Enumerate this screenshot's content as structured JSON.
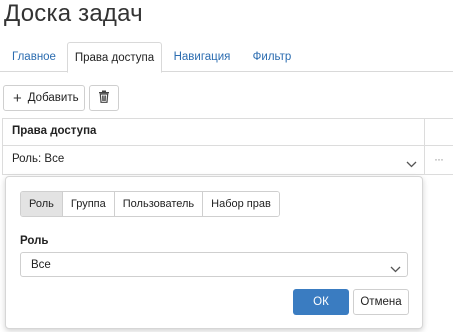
{
  "page": {
    "title": "Доска задач"
  },
  "tabs": [
    {
      "label": "Главное",
      "active": false
    },
    {
      "label": "Права доступа",
      "active": true
    },
    {
      "label": "Навигация",
      "active": false
    },
    {
      "label": "Фильтр",
      "active": false
    }
  ],
  "toolbar": {
    "add_label": "Добавить",
    "add_icon": "plus-icon",
    "delete_icon": "trash-icon"
  },
  "grid": {
    "header": "Права доступа",
    "rows": [
      {
        "value": "Роль: Все"
      }
    ],
    "row_menu": "···"
  },
  "popup": {
    "segments": [
      {
        "label": "Роль",
        "active": true
      },
      {
        "label": "Группа",
        "active": false
      },
      {
        "label": "Пользователь",
        "active": false
      },
      {
        "label": "Набор прав",
        "active": false
      }
    ],
    "field_label": "Роль",
    "select_value": "Все",
    "ok_label": "ОК",
    "cancel_label": "Отмена"
  },
  "colors": {
    "link": "#2b6cb0",
    "primary": "#3a7cc1",
    "border": "#cfcfcf",
    "segment_active": "#e3e3e3"
  }
}
